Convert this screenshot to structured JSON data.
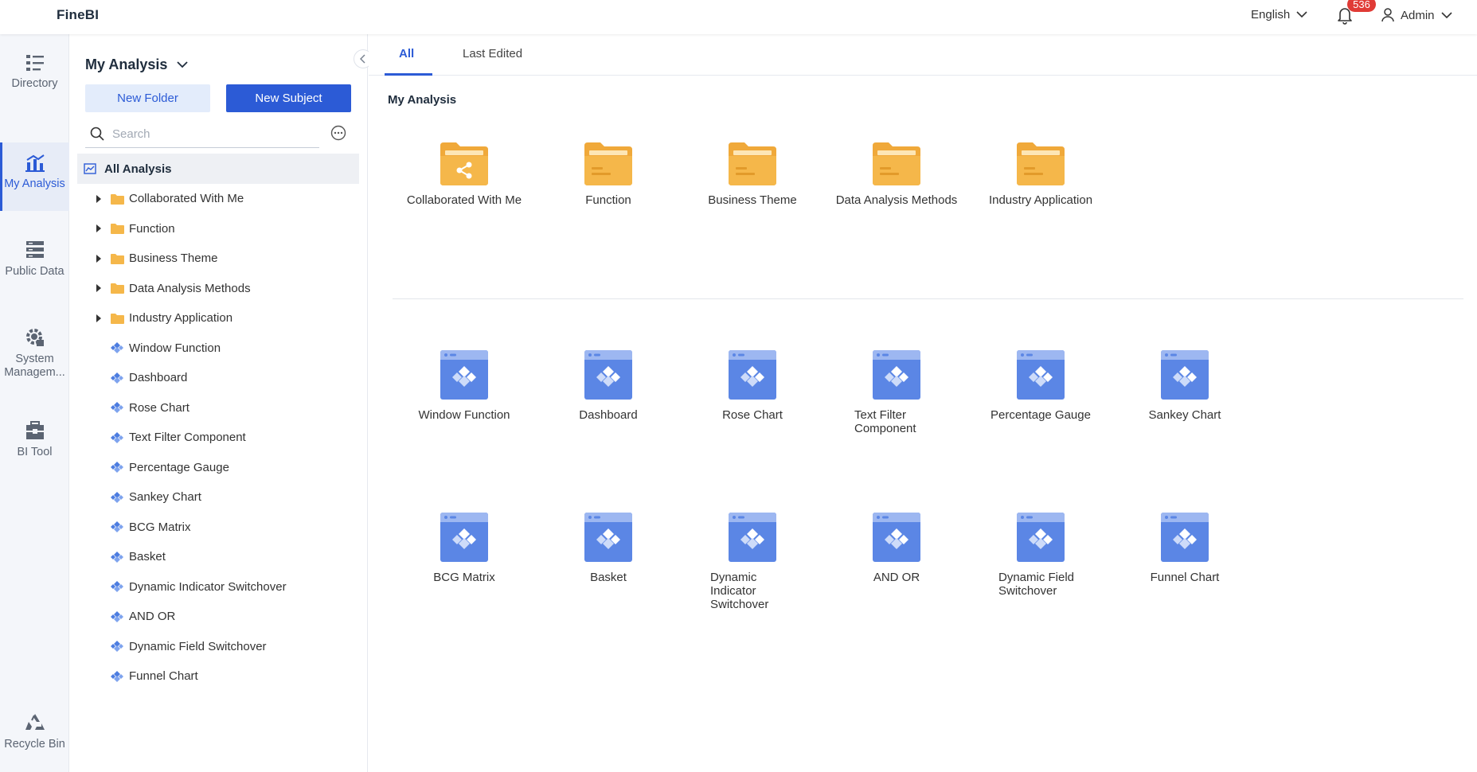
{
  "header": {
    "logo": "FineBI",
    "language": "English",
    "notification_count": "536",
    "user": "Admin"
  },
  "nav": {
    "items": [
      {
        "label": "Directory",
        "icon": "directory-icon"
      },
      {
        "label": "My Analysis",
        "icon": "analysis-chart-icon",
        "active": true
      },
      {
        "label": "Public Data",
        "icon": "database-icon"
      },
      {
        "label": "System Managem...",
        "icon": "gear-icon"
      },
      {
        "label": "BI Tool",
        "icon": "toolbox-icon"
      },
      {
        "label": "Recycle Bin",
        "icon": "recycle-icon"
      }
    ]
  },
  "sidebar": {
    "title": "My Analysis",
    "new_folder": "New Folder",
    "new_subject": "New Subject",
    "search_placeholder": "Search",
    "root": "All Analysis",
    "folders": [
      "Collaborated With Me",
      "Function",
      "Business Theme",
      "Data Analysis Methods",
      "Industry Application"
    ],
    "subjects": [
      "Window Function",
      "Dashboard",
      "Rose Chart",
      "Text Filter Component",
      "Percentage Gauge",
      "Sankey Chart",
      "BCG Matrix",
      "Basket",
      "Dynamic Indicator Switchover",
      "AND OR",
      "Dynamic Field Switchover",
      "Funnel Chart"
    ]
  },
  "main": {
    "tabs": [
      "All",
      "Last Edited"
    ],
    "active_tab": "All",
    "breadcrumb": "My Analysis",
    "folders": [
      "Collaborated With Me",
      "Function",
      "Business Theme",
      "Data Analysis Methods",
      "Industry Application"
    ],
    "subjects": [
      "Window Function",
      "Dashboard",
      "Rose Chart",
      "Text Filter Component",
      "Percentage Gauge",
      "Sankey Chart",
      "BCG Matrix",
      "Basket",
      "Dynamic Indicator Switchover",
      "AND OR",
      "Dynamic Field Switchover",
      "Funnel Chart"
    ]
  },
  "colors": {
    "accent": "#2c5bd6",
    "folder": "#f5b74a",
    "subject": "#5b86e5",
    "badge": "#e03b36"
  }
}
